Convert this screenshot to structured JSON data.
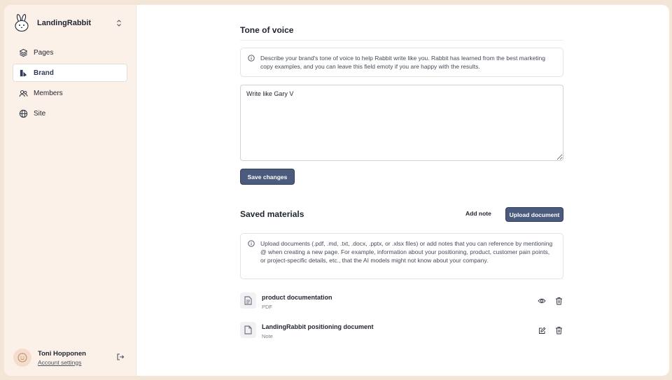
{
  "app": {
    "name": "LandingRabbit"
  },
  "sidebar": {
    "items": [
      {
        "label": "Pages",
        "icon": "layers-icon"
      },
      {
        "label": "Brand",
        "icon": "brand-icon",
        "active": true
      },
      {
        "label": "Members",
        "icon": "users-icon"
      },
      {
        "label": "Site",
        "icon": "globe-icon"
      }
    ],
    "user": {
      "name": "Toni Hopponen",
      "account_link": "Account settings"
    }
  },
  "tone": {
    "title": "Tone of voice",
    "info": "Describe your brand's tone of voice to help Rabbit write like you. Rabbit has learned from the best marketing copy examples, and you can leave this field emoty if you are happy with the results.",
    "value": "Write like Gary V",
    "save_label": "Save changes"
  },
  "materials": {
    "title": "Saved materials",
    "add_note_label": "Add note",
    "upload_label": "Upload document",
    "info": "Upload documents (.pdf, .md, .txt, .docx, .pptx, or .xlsx files) or add notes that you can reference by mentioning @ when creating a new page. For example, information about your positioning, product, customer pain points, or project-specific details, etc., that the AI models might not know about your company.",
    "documents": [
      {
        "title": "product documentation",
        "type": "PDF",
        "icon": "file-text-icon",
        "actions": [
          "eye-icon",
          "trash-icon"
        ]
      },
      {
        "title": "LandingRabbit positioning document",
        "type": "Note",
        "icon": "file-icon",
        "actions": [
          "edit-icon",
          "trash-icon"
        ]
      }
    ]
  },
  "colors": {
    "accent": "#4a5b7e",
    "sidebar_bg": "#fcf1e8",
    "page_bg": "#f4e6d6"
  }
}
